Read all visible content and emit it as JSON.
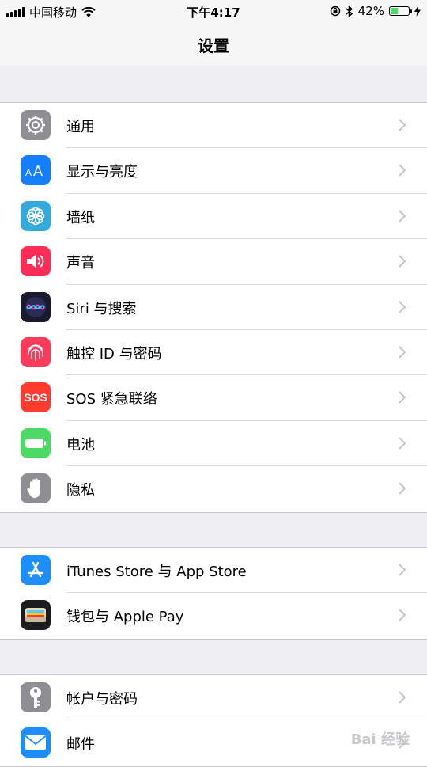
{
  "status_bar": {
    "carrier": "中国移动",
    "time": "下午4:17",
    "battery_percent": "42%",
    "battery_level": 0.42
  },
  "nav": {
    "title": "设置"
  },
  "groups": [
    {
      "items": [
        {
          "label": "通用",
          "icon": "gear-icon",
          "color": "#8e8e93"
        },
        {
          "label": "显示与亮度",
          "icon": "text-size-icon",
          "color": "#147efb"
        },
        {
          "label": "墙纸",
          "icon": "flower-icon",
          "color": "#34aadc"
        },
        {
          "label": "声音",
          "icon": "speaker-icon",
          "color": "#ff2d55"
        },
        {
          "label": "Siri 与搜索",
          "icon": "siri-icon",
          "color": "#1a1a2e"
        },
        {
          "label": "触控 ID 与密码",
          "icon": "fingerprint-icon",
          "color": "#ff3b5c"
        },
        {
          "label": "SOS 紧急联络",
          "icon": "sos-icon",
          "color": "#ff3b30",
          "icon_text": "SOS"
        },
        {
          "label": "电池",
          "icon": "battery-icon",
          "color": "#4cd964"
        },
        {
          "label": "隐私",
          "icon": "hand-icon",
          "color": "#8e8e93"
        }
      ]
    },
    {
      "items": [
        {
          "label": "iTunes Store 与 App Store",
          "icon": "app-store-icon",
          "color": "#1d8efb"
        },
        {
          "label": "钱包与 Apple Pay",
          "icon": "wallet-icon",
          "color": "#1c1c1e"
        }
      ]
    },
    {
      "items": [
        {
          "label": "帐户与密码",
          "icon": "key-icon",
          "color": "#8e8e93"
        },
        {
          "label": "邮件",
          "icon": "mail-icon",
          "color": "#1d8efb"
        }
      ]
    }
  ],
  "watermark": "Bai 经验"
}
